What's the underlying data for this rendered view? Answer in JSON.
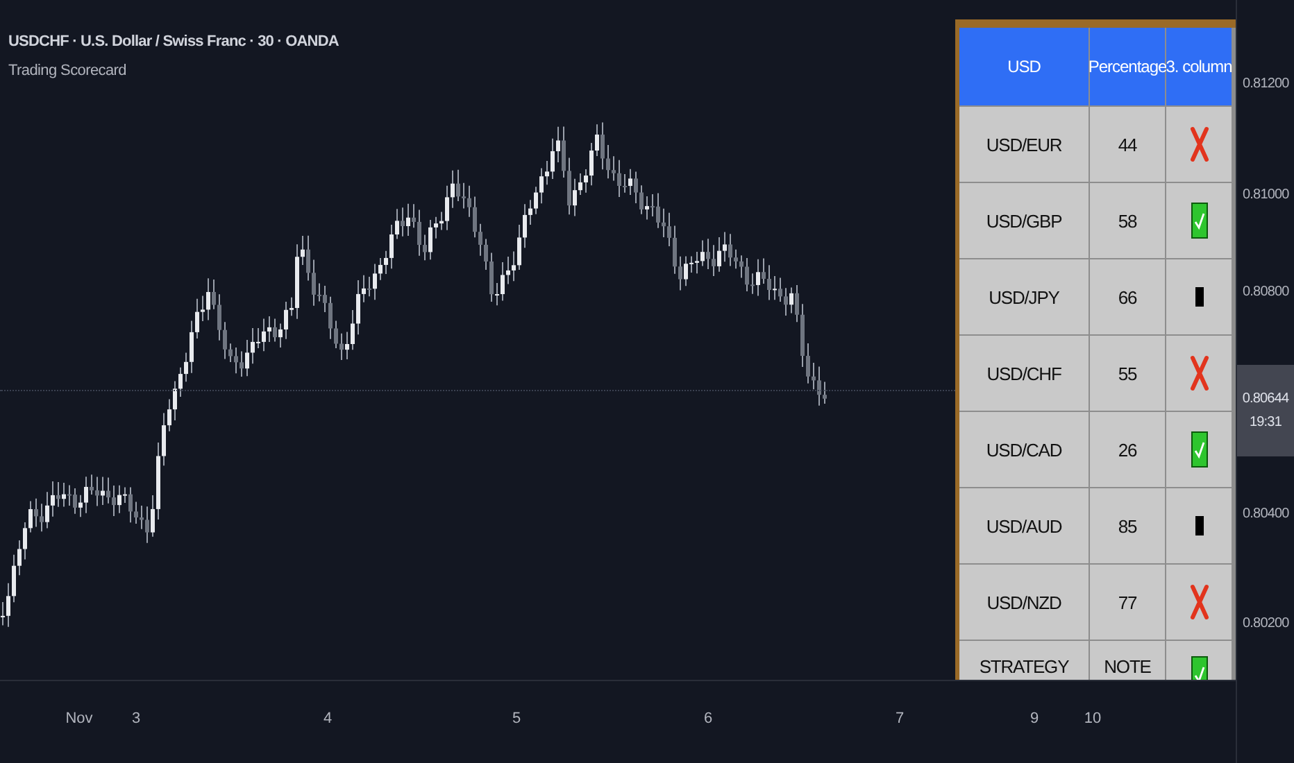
{
  "chart_header": {
    "symbol_line": "USDCHF · U.S. Dollar / Swiss Franc · 30 · OANDA",
    "indicator": "Trading Scorecard"
  },
  "scorecard": {
    "columns": [
      "USD",
      "Percentage",
      "3. column"
    ],
    "rows": [
      {
        "pair": "USD/EUR",
        "percentage": "44",
        "kind": "cross"
      },
      {
        "pair": "USD/GBP",
        "percentage": "58",
        "kind": "check"
      },
      {
        "pair": "USD/JPY",
        "percentage": "66",
        "kind": "neutral"
      },
      {
        "pair": "USD/CHF",
        "percentage": "55",
        "kind": "cross"
      },
      {
        "pair": "USD/CAD",
        "percentage": "26",
        "kind": "check"
      },
      {
        "pair": "USD/AUD",
        "percentage": "85",
        "kind": "neutral"
      },
      {
        "pair": "USD/NZD",
        "percentage": "77",
        "kind": "cross"
      },
      {
        "pair": "STRATEGY",
        "percentage": "NOTE",
        "kind": "check"
      }
    ]
  },
  "price_axis": {
    "ticks": [
      "0.81200",
      "0.81000",
      "0.80800",
      "0.80400",
      "0.80200"
    ],
    "last_price": "0.80644",
    "countdown": "19:31"
  },
  "time_axis": {
    "ticks": [
      "Nov",
      "3",
      "4",
      "5",
      "6",
      "7",
      "9",
      "10"
    ]
  }
}
